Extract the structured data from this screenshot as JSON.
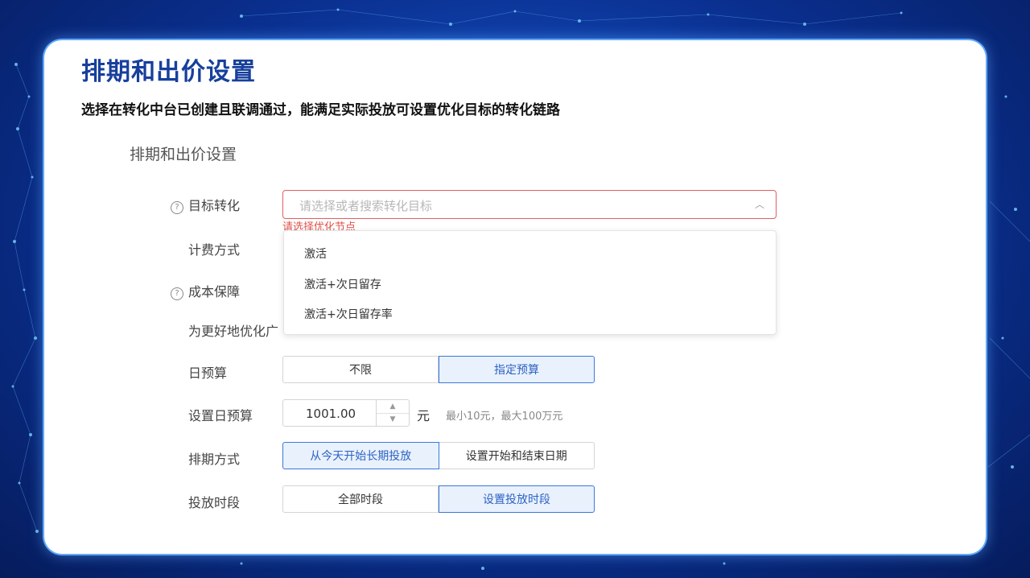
{
  "title": "排期和出价设置",
  "subtitle": "选择在转化中台已创建且联调通过，能满足实际投放可设置优化目标的转化链路",
  "section_title": "排期和出价设置",
  "form": {
    "target_label": "目标转化",
    "target_placeholder": "请选择或者搜索转化目标",
    "target_error": "请选择优化节点",
    "billing_label": "计费方式",
    "cost_label": "成本保障",
    "optimize_label": "为更好地优化广",
    "daily_budget_label": "日预算",
    "daily_budget_options": [
      "不限",
      "指定预算"
    ],
    "set_budget_label": "设置日预算",
    "budget_value": "1001.00",
    "budget_unit": "元",
    "budget_hint": "最小10元，最大100万元",
    "schedule_label": "排期方式",
    "schedule_options": [
      "从今天开始长期投放",
      "设置开始和结束日期"
    ],
    "time_label": "投放时段",
    "time_options": [
      "全部时段",
      "设置投放时段"
    ]
  },
  "dropdown": {
    "items": [
      "激活",
      "激活+次日留存",
      "激活+次日留存率"
    ]
  },
  "icons": {
    "help": "question-circle-icon",
    "chevron": "chevron-up-icon",
    "step_up": "caret-up-icon",
    "step_down": "caret-down-icon"
  },
  "colors": {
    "title": "#173f9c",
    "error": "#e0504a",
    "active": "#3b79d8"
  }
}
